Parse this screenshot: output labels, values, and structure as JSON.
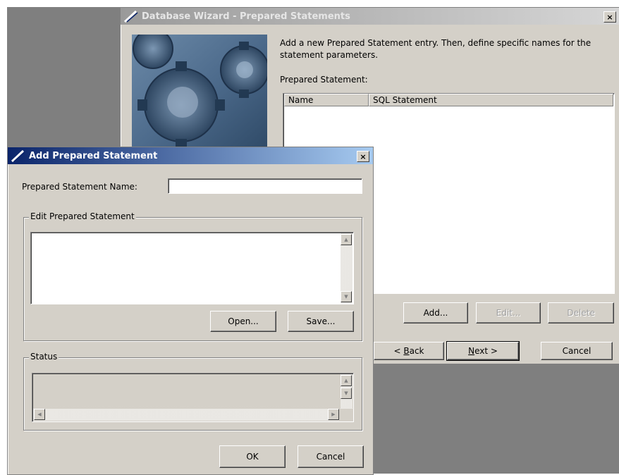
{
  "wizard": {
    "title": "Database Wizard - Prepared Statements",
    "close_label": "×",
    "description": "Add a new Prepared Statement entry.  Then, define specific names for the statement parameters.",
    "list_label": "Prepared Statement:",
    "columns": [
      "Name",
      "SQL Statement"
    ],
    "buttons": {
      "add": "Add...",
      "edit": "Edit...",
      "delete": "Delete",
      "back_accel": "B",
      "back_prefix": "< ",
      "back_rest": "ack",
      "next_accel": "N",
      "next_rest": "ext >",
      "cancel": "Cancel"
    }
  },
  "dialog": {
    "title": "Add Prepared Statement",
    "close_label": "×",
    "name_label": "Prepared Statement Name:",
    "name_value": "",
    "edit_group_label": "Edit Prepared Statement",
    "edit_value": "",
    "open_label": "Open...",
    "save_label": "Save...",
    "status_group_label": "Status",
    "status_value": "",
    "ok_label": "OK",
    "cancel_label": "Cancel"
  },
  "colors": {
    "active_title_start": "#0a246a",
    "active_title_end": "#a6caf0",
    "face": "#d4d0c8"
  },
  "icons": {
    "app_icon": "slash-logo-icon",
    "scroll_up": "triangle-up-icon",
    "scroll_down": "triangle-down-icon",
    "scroll_left": "triangle-left-icon",
    "scroll_right": "triangle-right-icon"
  }
}
